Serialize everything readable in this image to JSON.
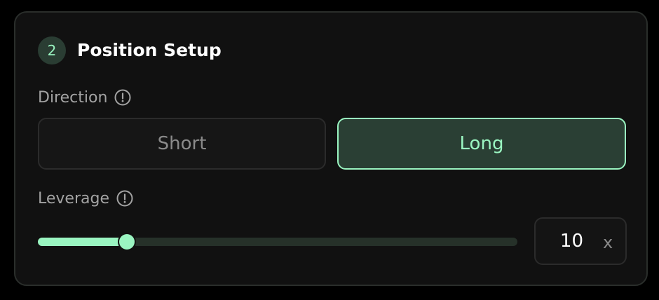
{
  "section": {
    "step_number": "2",
    "title": "Position Setup"
  },
  "direction": {
    "label": "Direction",
    "info_icon": "info-circle-icon",
    "options": [
      "Short",
      "Long"
    ],
    "selected": "Long"
  },
  "leverage": {
    "label": "Leverage",
    "info_icon": "info-circle-icon",
    "value": "10",
    "unit": "x",
    "slider_fraction": 0.185
  },
  "colors": {
    "accent": "#9af5c1",
    "accent_bg": "#2a3f34",
    "card_bg": "#111111",
    "track_bg": "#263129"
  }
}
